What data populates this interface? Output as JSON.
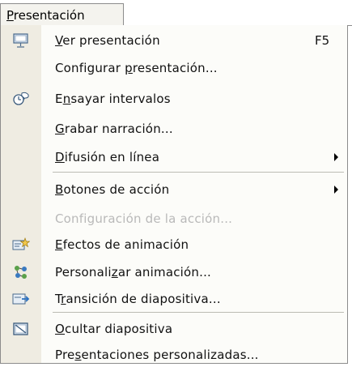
{
  "menu": {
    "title": "Presentación",
    "title_hotkey": "P",
    "title_rest": "resentación"
  },
  "items": [
    {
      "pre": "",
      "hot": "V",
      "post": "er presentación",
      "shortcut": "F5",
      "icon": "slideshow-screen-icon"
    },
    {
      "pre": "Configurar ",
      "hot": "p",
      "post": "resentación...",
      "icon": ""
    },
    {
      "pre": "E",
      "hot": "n",
      "post": "sayar intervalos",
      "icon": "rehearse-timings-icon"
    },
    {
      "pre": "",
      "hot": "G",
      "post": "rabar narración...",
      "icon": ""
    },
    {
      "pre": "",
      "hot": "D",
      "post": "ifusión en línea",
      "submenu": true,
      "icon": ""
    },
    {
      "pre": "",
      "hot": "B",
      "post": "otones de acción",
      "submenu": true,
      "icon": ""
    },
    {
      "text": "Configuración de la acción...",
      "disabled": true,
      "icon": ""
    },
    {
      "pre": "",
      "hot": "E",
      "post": "fectos de animación",
      "icon": "animation-effects-icon"
    },
    {
      "pre": "Personali",
      "hot": "z",
      "post": "ar animación...",
      "icon": "custom-animation-icon"
    },
    {
      "pre": "T",
      "hot": "r",
      "post": "ansición de diapositiva...",
      "icon": "slide-transition-icon"
    },
    {
      "pre": "",
      "hot": "O",
      "post": "cultar diapositiva",
      "icon": "hide-slide-icon"
    },
    {
      "pre": "Pre",
      "hot": "s",
      "post": "entaciones personalizadas...",
      "icon": ""
    }
  ],
  "colors": {
    "gutter": "#efece2",
    "menu_bg": "#fcfcf9",
    "disabled_text": "#b9b9b9",
    "border": "#8c8c8c"
  }
}
